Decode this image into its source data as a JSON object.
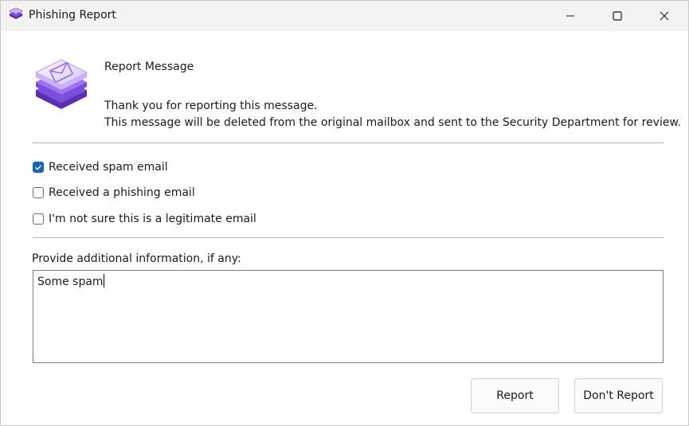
{
  "window": {
    "title": "Phishing Report"
  },
  "header": {
    "title": "Report Message",
    "thanks": "Thank you for reporting this message.",
    "description": "This message will be deleted from the original mailbox and sent to the Security Department for review."
  },
  "options": [
    {
      "label": "Received spam email",
      "checked": true
    },
    {
      "label": "Received a phishing email",
      "checked": false
    },
    {
      "label": "I'm not sure this is a legitimate email",
      "checked": false
    }
  ],
  "info": {
    "label": "Provide additional information, if any:",
    "value": "Some spam"
  },
  "buttons": {
    "report": "Report",
    "dont_report": "Don't Report"
  },
  "colors": {
    "accent": "#1863b6",
    "icon_purple": "#8b5cf6"
  }
}
